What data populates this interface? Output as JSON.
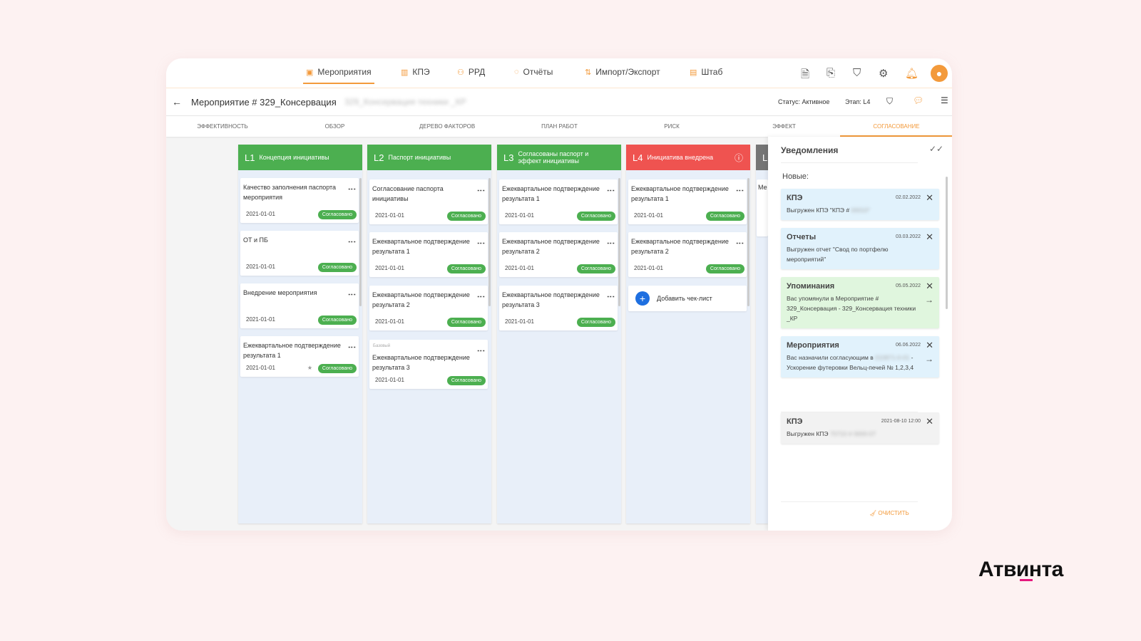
{
  "nav": {
    "items": [
      {
        "label": "Мероприятия",
        "icon": "▣"
      },
      {
        "label": "КПЭ",
        "icon": "▥"
      },
      {
        "label": "РРД",
        "icon": "⚇"
      },
      {
        "label": "Отчёты",
        "icon": "◌"
      },
      {
        "label": "Импорт/Экспорт",
        "icon": "⇅"
      },
      {
        "label": "Штаб",
        "icon": "▤"
      }
    ],
    "active": 0
  },
  "header": {
    "back": "←",
    "title": "Мероприятие # 329_Консервация",
    "subtitle_blurred": "329_Консервация техники _КР",
    "status": "Статус: Активное",
    "stage": "Этап: L4"
  },
  "tabs": [
    "ЭФФЕКТИВНОСТЬ",
    "ОБЗОР",
    "ДЕРЕВО ФАКТОРОВ",
    "ПЛАН РАБОТ",
    "РИСК",
    "ЭФФЕКТ",
    "СОГЛАСОВАНИЕ"
  ],
  "colors": {
    "accent": "#f39a3b",
    "green": "#4caf50",
    "red": "#ef5350",
    "gray": "#757575"
  },
  "columns": [
    {
      "level": "L1",
      "title": "Концепция инициативы",
      "color": "#4caf50",
      "cards": [
        {
          "title": "Качество заполнения паспорта мероприятия",
          "date": "2021-01-01",
          "status": "Согласовано"
        },
        {
          "title": "ОТ и ПБ",
          "date": "2021-01-01",
          "status": "Согласовано"
        },
        {
          "title": "Внедрение мероприятия",
          "date": "2021-01-01",
          "status": "Согласовано"
        },
        {
          "title": "Ежеквартальное подтверждение результата 1",
          "date": "2021-01-01",
          "status": "Согласовано",
          "starred": true
        }
      ]
    },
    {
      "level": "L2",
      "title": "Паспорт инициативы",
      "color": "#4caf50",
      "cards": [
        {
          "title": "Согласование паспорта инициативы",
          "date": "2021-01-01",
          "status": "Согласовано"
        },
        {
          "title": "Ежеквартальное подтверждение результата 1",
          "date": "2021-01-01",
          "status": "Согласовано"
        },
        {
          "title": "Ежеквартальное подтверждение результата 2",
          "date": "2021-01-01",
          "status": "Согласовано"
        },
        {
          "title": "Ежеквартальное подтверждение результата 3",
          "date": "2021-01-01",
          "status": "Согласовано",
          "tag": "Базовый"
        }
      ]
    },
    {
      "level": "L3",
      "title": "Согласованы паспорт и эффект инициативы",
      "color": "#4caf50",
      "cards": [
        {
          "title": "Ежеквартальное подтверждение результата 1",
          "date": "2021-01-01",
          "status": "Согласовано"
        },
        {
          "title": "Ежеквартальное подтверждение результата 2",
          "date": "2021-01-01",
          "status": "Согласовано"
        },
        {
          "title": "Ежеквартальное подтверждение результата 3",
          "date": "2021-01-01",
          "status": "Согласовано"
        }
      ]
    },
    {
      "level": "L4",
      "title": "Инициатива внедрена",
      "color": "#ef5350",
      "cards": [
        {
          "title": "Ежеквартальное подтверждение результата 1",
          "date": "2021-01-01",
          "status": "Согласовано"
        },
        {
          "title": "Ежеквартальное подтверждение результата 2",
          "date": "2021-01-01",
          "status": "Согласовано"
        }
      ],
      "add_label": "Добавить чек-лист"
    },
    {
      "level": "L",
      "title": "",
      "color": "#757575",
      "cards": [
        {
          "title": "Ме"
        }
      ]
    }
  ],
  "notifications": {
    "title": "Уведомления",
    "new_label": "Новые:",
    "clear_label": "ОЧИСТИТЬ",
    "items": [
      {
        "title": "КПЭ",
        "date": "02.02.2022",
        "text": "Выгружен КПЭ \"КПЭ # ",
        "blur": "00010\"",
        "bg": "#e1f2fc"
      },
      {
        "title": "Отчеты",
        "date": "03.03.2022",
        "text": "Выгружен отчет \"Свод по портфелю мероприятий\"",
        "bg": "#e1f2fc"
      },
      {
        "title": "Упоминания",
        "date": "05.05.2022",
        "text": "Вас упомянули в  Мероприятие # 329_Консервация - 329_Консервация техники _КР",
        "bg": "#e0f6de",
        "arrow": true
      },
      {
        "title": "Мероприятия",
        "date": "06.06.2022",
        "text": "Вас назначили согласующим в ",
        "blur": "010871-0-01",
        "text2": " - Ускорение футеровки Вельц-печей № 1,2,3,4",
        "bg": "#e1f2fc",
        "arrow": true
      },
      {
        "title": "КПЭ",
        "date": "2021-08-10  12:00",
        "text": "Выгружен КПЭ ",
        "blur": "70710 # 0000-07",
        "bg": "#f2f2f2"
      }
    ]
  },
  "logo": "Атвинта"
}
